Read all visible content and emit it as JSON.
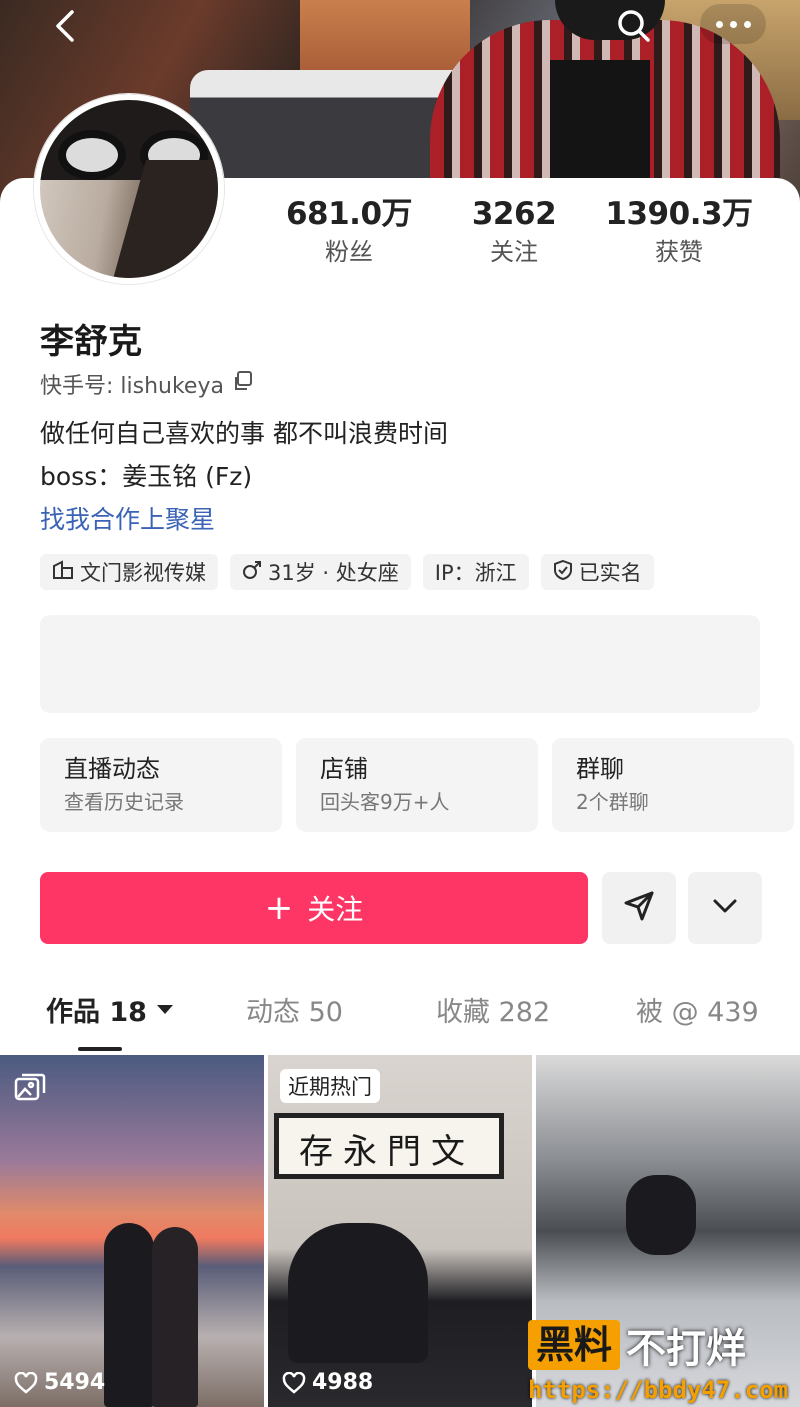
{
  "header": {
    "back_icon": "chevron-left-icon",
    "search_icon": "search-icon",
    "more_icon": "more-dots-icon"
  },
  "profile": {
    "stats": [
      {
        "value": "681.0万",
        "label": "粉丝"
      },
      {
        "value": "3262",
        "label": "关注"
      },
      {
        "value": "1390.3万",
        "label": "获赞"
      }
    ],
    "name": "李舒克",
    "kuaishou_id": "快手号: lishukeya",
    "bio": [
      "做任何自己喜欢的事 都不叫浪费时间",
      "boss：姜玉铭 (Fz)"
    ],
    "link": "找我合作上聚星",
    "tags": [
      "文门影视传媒",
      "31岁 · 处女座",
      "IP：浙江",
      "已实名"
    ]
  },
  "tiles": [
    {
      "title": "直播动态",
      "sub": "查看历史记录"
    },
    {
      "title": "店铺",
      "sub": "回头客9万+人"
    },
    {
      "title": "群聊",
      "sub": "2个群聊"
    }
  ],
  "actions": {
    "follow_plus": "+",
    "follow_label": "关注"
  },
  "tabs": [
    {
      "label": "作品 18"
    },
    {
      "label": "动态 50"
    },
    {
      "label": "收藏 282"
    },
    {
      "label": "被 @ 439"
    }
  ],
  "grid": [
    {
      "likes": "5494"
    },
    {
      "badge": "近期热门",
      "scroll_text": "存永門文",
      "likes": "4988"
    },
    {}
  ],
  "watermark": {
    "box": "黑料",
    "text": "不打烊",
    "url": "https://bbdy47.com"
  },
  "colors": {
    "accent": "#fe3666",
    "link": "#3b63b5",
    "watermark": "#f5a000"
  }
}
